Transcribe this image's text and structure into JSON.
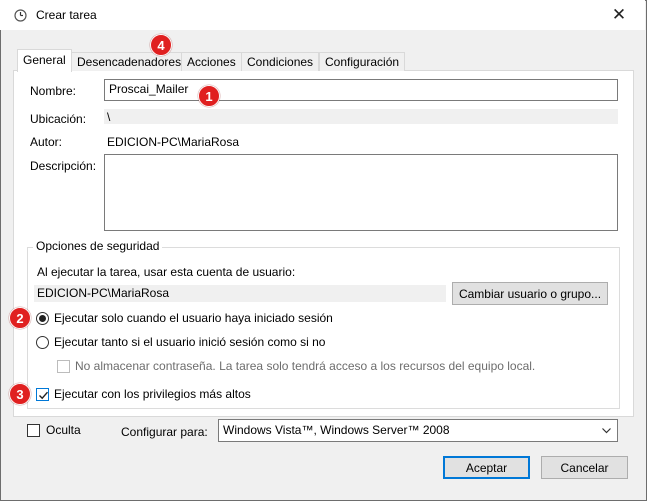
{
  "window": {
    "title": "Crear tarea",
    "close_glyph": "✕"
  },
  "tabs": [
    {
      "label": "General",
      "active": true
    },
    {
      "label": "Desencadenadores",
      "active": false
    },
    {
      "label": "Acciones",
      "active": false
    },
    {
      "label": "Condiciones",
      "active": false
    },
    {
      "label": "Configuración",
      "active": false
    }
  ],
  "general": {
    "name_label": "Nombre:",
    "name_value": "Proscai_Mailer",
    "location_label": "Ubicación:",
    "location_value": "\\",
    "author_label": "Autor:",
    "author_value": "EDICION-PC\\MariaRosa",
    "description_label": "Descripción:",
    "description_value": ""
  },
  "security": {
    "group_title": "Opciones de seguridad",
    "account_prompt": "Al ejecutar la tarea, usar esta cuenta de usuario:",
    "account_value": "EDICION-PC\\MariaRosa",
    "change_user_button": "Cambiar usuario o grupo...",
    "radio_logged_on": "Ejecutar solo cuando el usuario haya iniciado sesión",
    "radio_logged_on_selected": true,
    "radio_any": "Ejecutar tanto si el usuario inició sesión como si no",
    "radio_any_selected": false,
    "no_store_password": "No almacenar contraseña. La tarea solo tendrá acceso a los recursos del equipo local.",
    "highest_privileges": "Ejecutar con los privilegios más altos",
    "highest_privileges_checked": true
  },
  "footer": {
    "hidden_label": "Oculta",
    "hidden_checked": false,
    "configure_label": "Configurar para:",
    "configure_value": "Windows Vista™, Windows Server™ 2008",
    "accept_button": "Aceptar",
    "cancel_button": "Cancelar"
  },
  "annotations": [
    "1",
    "2",
    "3",
    "4"
  ],
  "colors": {
    "badge": "#e02020",
    "focus": "#0078d7"
  }
}
